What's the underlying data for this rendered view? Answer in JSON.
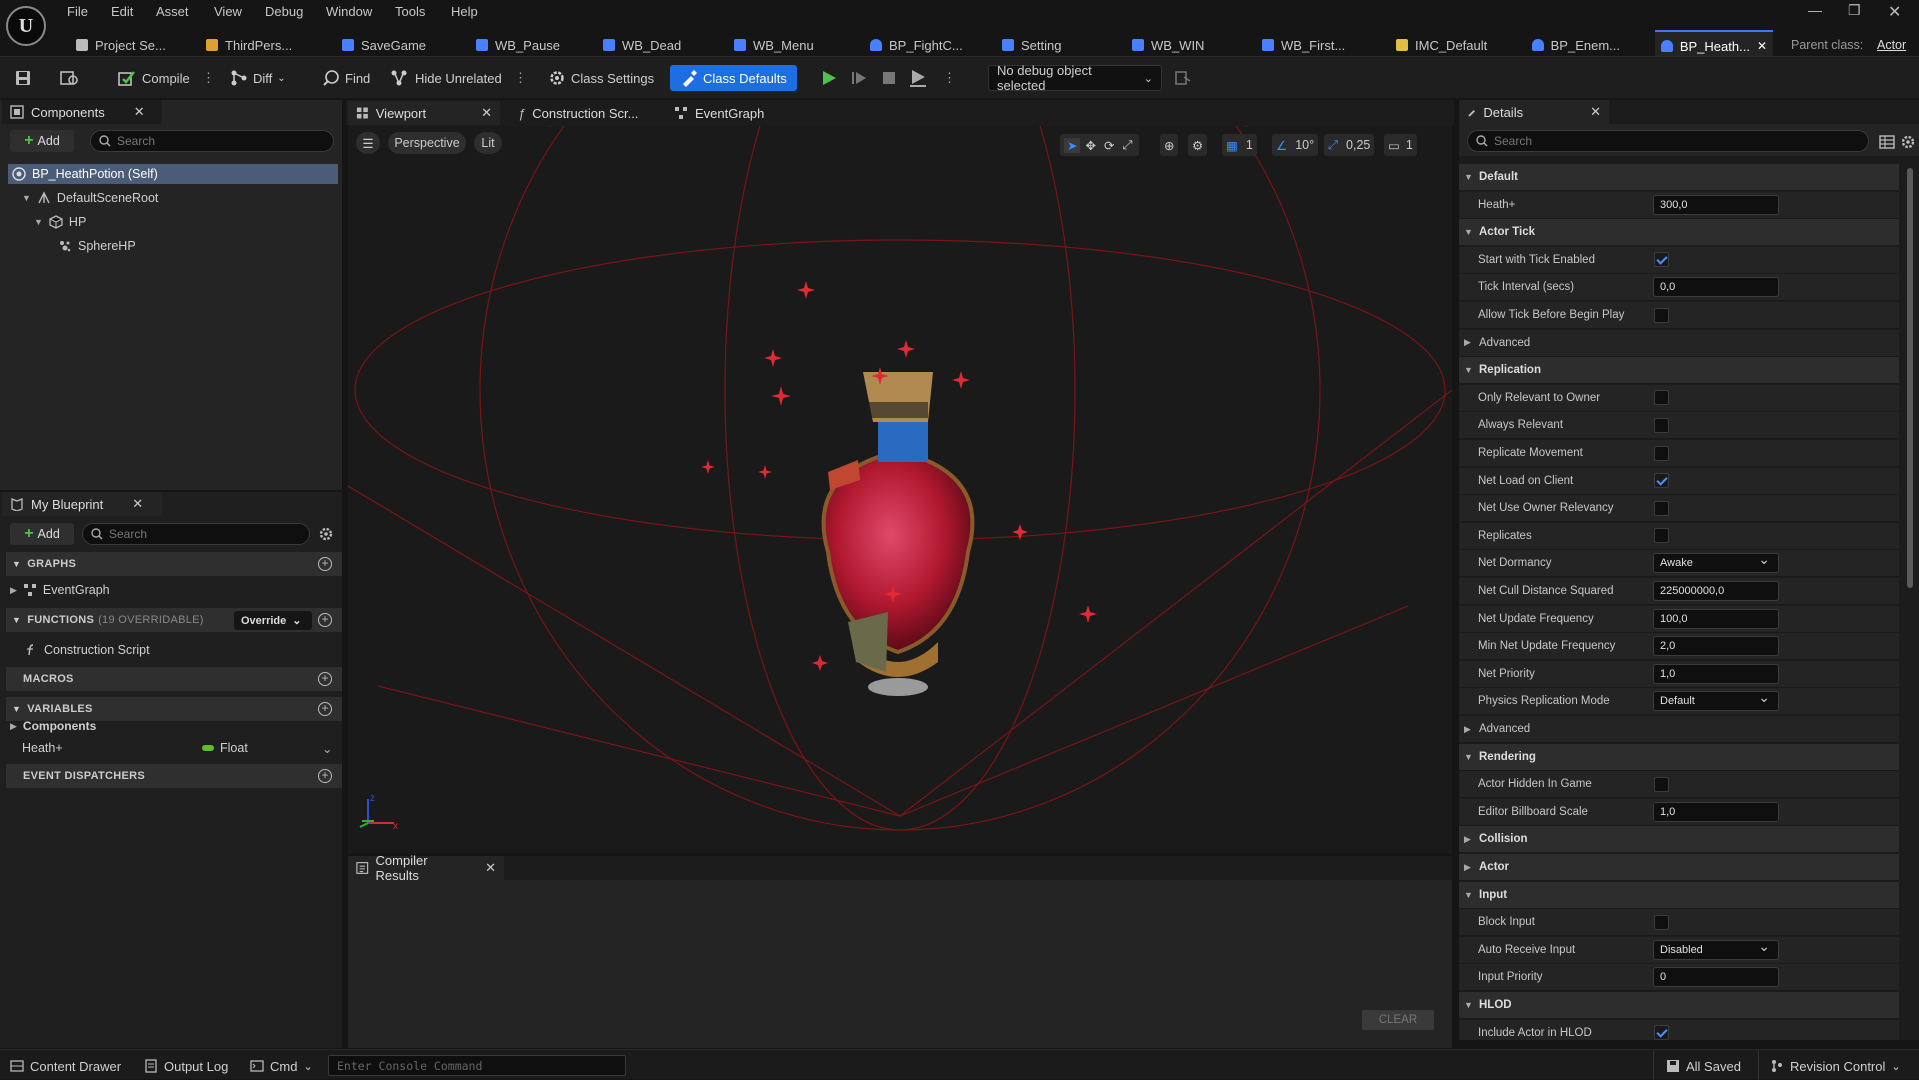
{
  "menu": [
    "File",
    "Edit",
    "Asset",
    "View",
    "Debug",
    "Window",
    "Tools",
    "Help"
  ],
  "doc_tabs": [
    {
      "label": "Project Se...",
      "icon": "gear-icon",
      "color": "#bbbbbb"
    },
    {
      "label": "ThirdPers...",
      "icon": "level-icon",
      "color": "#e0a030"
    },
    {
      "label": "SaveGame",
      "icon": "blueprint-icon",
      "color": "#4a80ff"
    },
    {
      "label": "WB_Pause",
      "icon": "widget-icon",
      "color": "#4a80ff"
    },
    {
      "label": "WB_Dead",
      "icon": "widget-icon",
      "color": "#4a80ff"
    },
    {
      "label": "WB_Menu",
      "icon": "widget-icon",
      "color": "#4a80ff"
    },
    {
      "label": "BP_FightC...",
      "icon": "character-icon",
      "color": "#4a80ff"
    },
    {
      "label": "Setting",
      "icon": "widget-icon",
      "color": "#4a80ff"
    },
    {
      "label": "WB_WIN",
      "icon": "widget-icon",
      "color": "#4a80ff"
    },
    {
      "label": "WB_First...",
      "icon": "widget-icon",
      "color": "#4a80ff"
    },
    {
      "label": "IMC_Default",
      "icon": "input-icon",
      "color": "#e0c040"
    },
    {
      "label": "BP_Enem...",
      "icon": "character-icon",
      "color": "#4a80ff"
    },
    {
      "label": "BP_Heath...",
      "icon": "character-icon",
      "color": "#4a80ff",
      "active": true
    }
  ],
  "parent_class": {
    "label": "Parent class:",
    "value": "Actor"
  },
  "toolbar": {
    "compile": "Compile",
    "diff": "Diff",
    "find": "Find",
    "hide_unrelated": "Hide Unrelated",
    "class_settings": "Class Settings",
    "class_defaults": "Class Defaults",
    "debug_object": "No debug object selected"
  },
  "components": {
    "tab": "Components",
    "add": "Add",
    "search_placeholder": "Search",
    "tree": [
      {
        "label": "BP_HeathPotion (Self)",
        "level": 0
      },
      {
        "label": "DefaultSceneRoot",
        "level": 1
      },
      {
        "label": "HP",
        "level": 2
      },
      {
        "label": "SphereHP",
        "level": 3
      }
    ]
  },
  "my_blueprint": {
    "tab": "My Blueprint",
    "add": "Add",
    "search_placeholder": "Search",
    "graphs": "GRAPHS",
    "event_graph": "EventGraph",
    "functions": "FUNCTIONS",
    "functions_count": "(19 OVERRIDABLE)",
    "override": "Override",
    "construction_script": "Construction Script",
    "macros": "MACROS",
    "variables": "VARIABLES",
    "components_cat": "Components",
    "var_name": "Heath+",
    "var_type": "Float",
    "var_type_color": "#5ac22e",
    "event_dispatchers": "EVENT DISPATCHERS"
  },
  "center_tabs": {
    "viewport": "Viewport",
    "construction": "Construction Scr...",
    "event_graph": "EventGraph"
  },
  "viewport": {
    "perspective": "Perspective",
    "lit": "Lit",
    "grid": "1",
    "angle": "10°",
    "scale": "0,25",
    "camera": "1"
  },
  "compiler": {
    "tab": "Compiler Results",
    "clear": "CLEAR"
  },
  "details": {
    "tab": "Details",
    "search_placeholder": "Search",
    "rows": [
      {
        "type": "cat",
        "label": "Default",
        "open": true
      },
      {
        "type": "text",
        "label": "Heath+",
        "value": "300,0"
      },
      {
        "type": "cat",
        "label": "Actor Tick",
        "open": true
      },
      {
        "type": "check",
        "label": "Start with Tick Enabled",
        "value": true
      },
      {
        "type": "text",
        "label": "Tick Interval (secs)",
        "value": "0,0"
      },
      {
        "type": "check",
        "label": "Allow Tick Before Begin Play",
        "value": false
      },
      {
        "type": "sub",
        "label": "Advanced"
      },
      {
        "type": "cat",
        "label": "Replication",
        "open": true
      },
      {
        "type": "check",
        "label": "Only Relevant to Owner",
        "value": false
      },
      {
        "type": "check",
        "label": "Always Relevant",
        "value": false
      },
      {
        "type": "check",
        "label": "Replicate Movement",
        "value": false
      },
      {
        "type": "check",
        "label": "Net Load on Client",
        "value": true
      },
      {
        "type": "check",
        "label": "Net Use Owner Relevancy",
        "value": false
      },
      {
        "type": "check",
        "label": "Replicates",
        "value": false
      },
      {
        "type": "select",
        "label": "Net Dormancy",
        "value": "Awake"
      },
      {
        "type": "text",
        "label": "Net Cull Distance Squared",
        "value": "225000000,0"
      },
      {
        "type": "text",
        "label": "Net Update Frequency",
        "value": "100,0"
      },
      {
        "type": "text",
        "label": "Min Net Update Frequency",
        "value": "2,0"
      },
      {
        "type": "text",
        "label": "Net Priority",
        "value": "1,0"
      },
      {
        "type": "select",
        "label": "Physics Replication Mode",
        "value": "Default"
      },
      {
        "type": "sub",
        "label": "Advanced"
      },
      {
        "type": "cat",
        "label": "Rendering",
        "open": true
      },
      {
        "type": "check",
        "label": "Actor Hidden In Game",
        "value": false
      },
      {
        "type": "text",
        "label": "Editor Billboard Scale",
        "value": "1,0"
      },
      {
        "type": "cat",
        "label": "Collision",
        "open": false
      },
      {
        "type": "cat",
        "label": "Actor",
        "open": false
      },
      {
        "type": "cat",
        "label": "Input",
        "open": true
      },
      {
        "type": "check",
        "label": "Block Input",
        "value": false
      },
      {
        "type": "select",
        "label": "Auto Receive Input",
        "value": "Disabled"
      },
      {
        "type": "text",
        "label": "Input Priority",
        "value": "0"
      },
      {
        "type": "cat",
        "label": "HLOD",
        "open": true
      },
      {
        "type": "check",
        "label": "Include Actor in HLOD",
        "value": true
      }
    ]
  },
  "statusbar": {
    "content_drawer": "Content Drawer",
    "output_log": "Output Log",
    "cmd": "Cmd",
    "console_placeholder": "Enter Console Command",
    "all_saved": "All Saved",
    "revision_control": "Revision Control"
  },
  "colors": {
    "accent": "#1d6ee0",
    "sparkle": "#e02a35",
    "potion_liquid": "#c0203a",
    "cork": "#b89050",
    "wire": "#8a1a1a"
  }
}
